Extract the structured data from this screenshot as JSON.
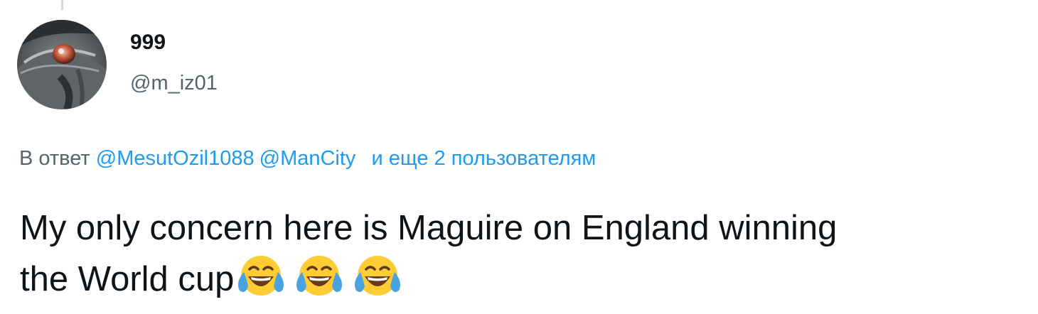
{
  "tweet": {
    "author": {
      "display_name": "999",
      "handle": "@m_iz01",
      "avatar_icon": "avatar-photo"
    },
    "reply_context": {
      "prefix": "В ответ",
      "mentions": [
        "@MesutOzil1088",
        "@ManCity"
      ],
      "others": "и еще 2 пользователям"
    },
    "text_line_1": "My only concern here is Maguire on England winning",
    "text_line_2": "the World cup",
    "emojis": [
      "face-with-tears-of-joy-icon",
      "face-with-tears-of-joy-icon",
      "face-with-tears-of-joy-icon"
    ],
    "colors": {
      "link": "#1d9bf0",
      "secondary_text": "#536471",
      "primary_text": "#0f1419"
    }
  }
}
